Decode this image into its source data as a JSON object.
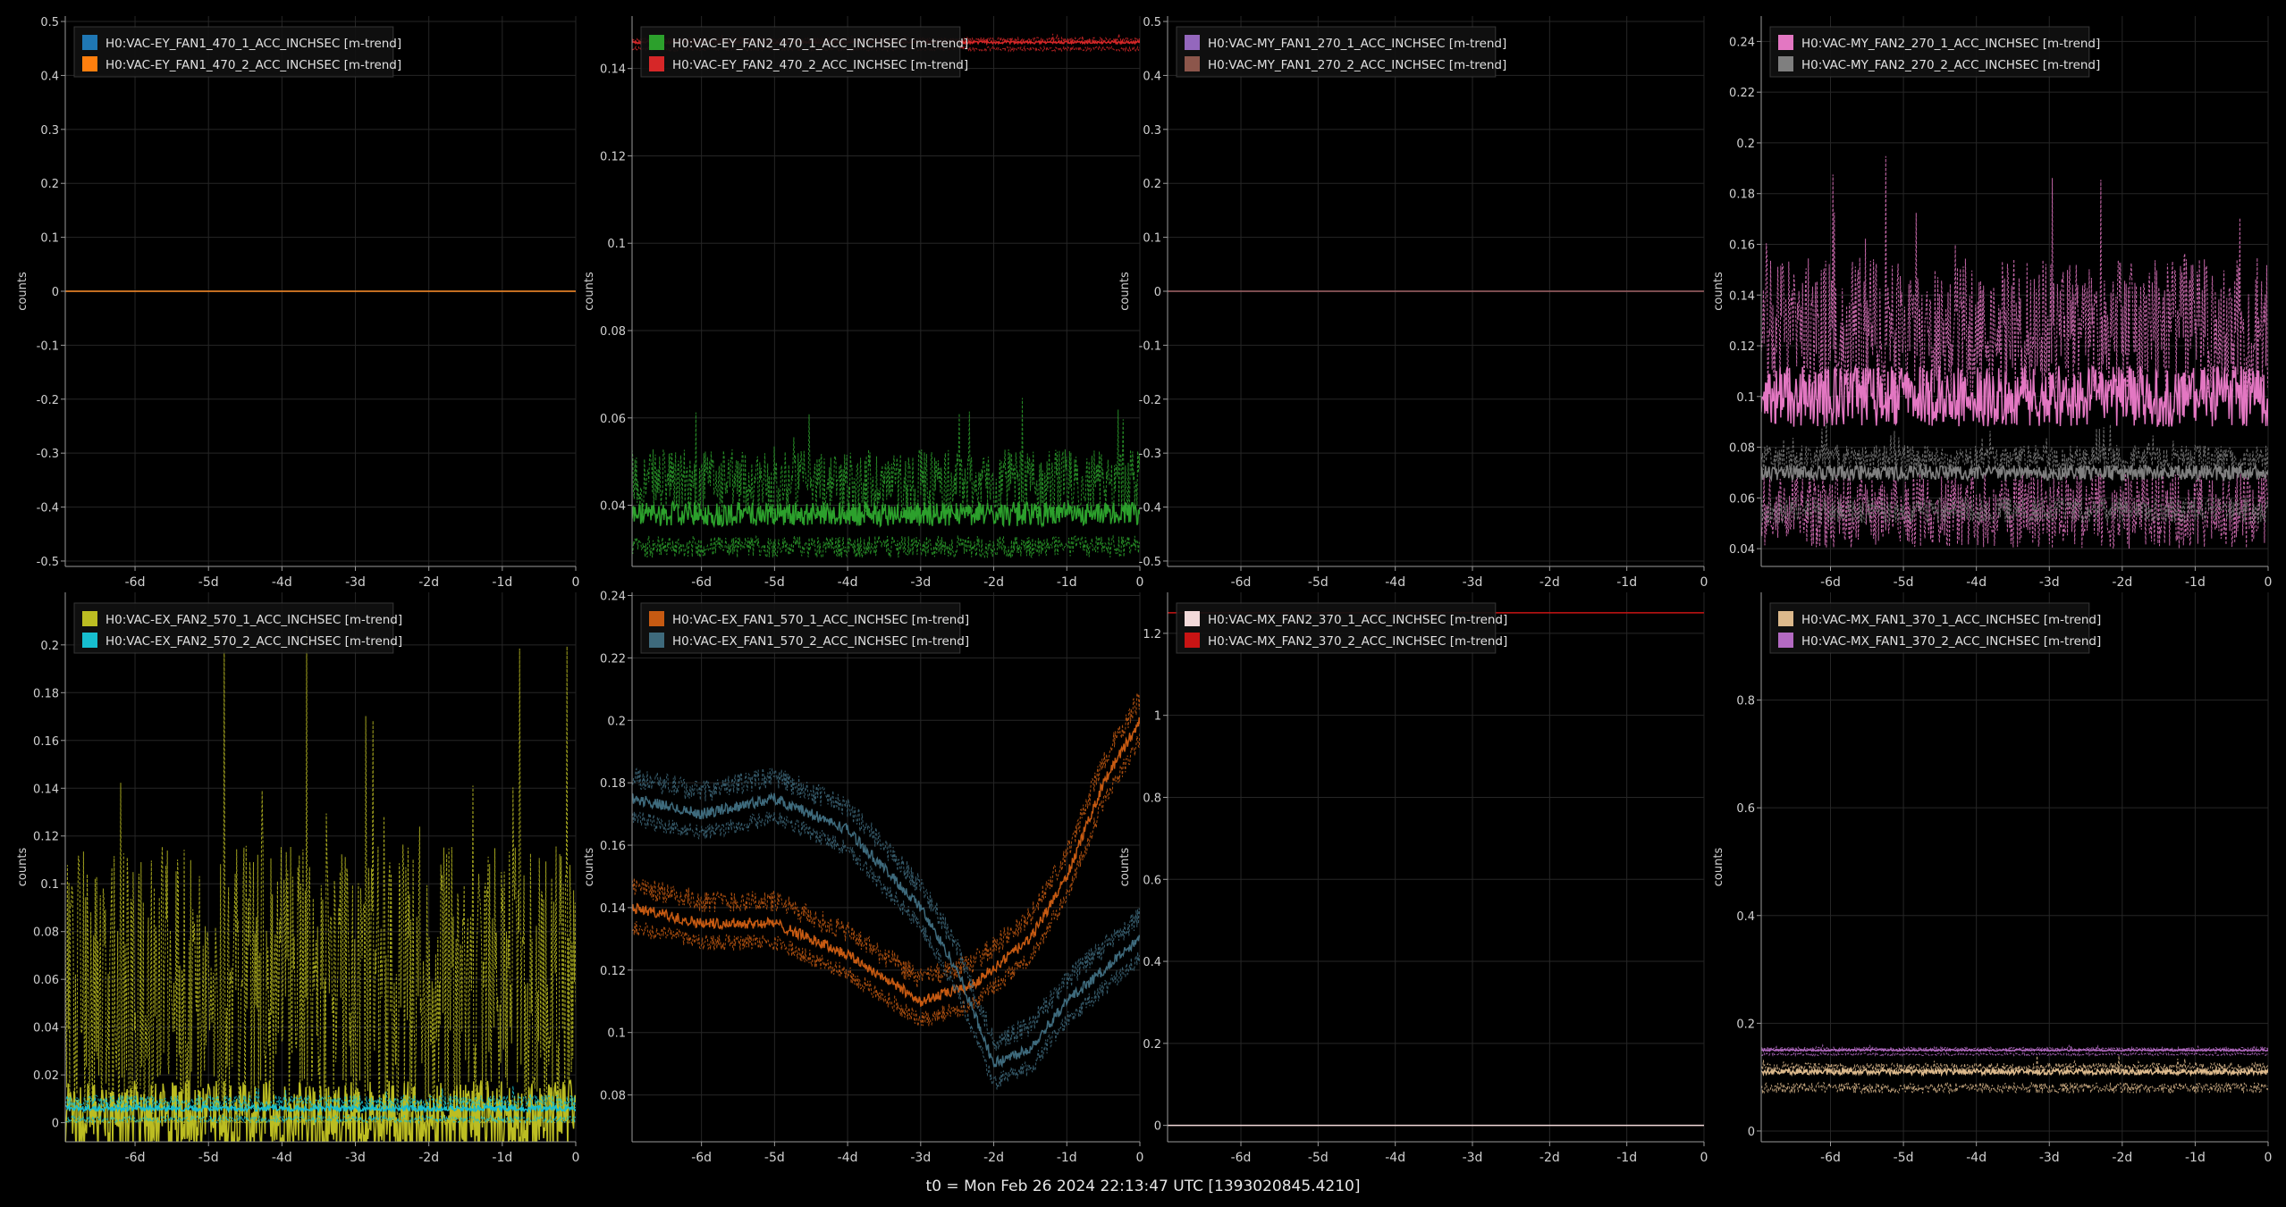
{
  "footer": "t0 = Mon Feb 26 2024 22:13:47 UTC [1393020845.4210]",
  "common": {
    "ylabel": "counts",
    "x_ticks": [
      -6,
      -5,
      -4,
      -3,
      -2,
      -1,
      0
    ],
    "x_tick_labels": [
      "-6d",
      "-5d",
      "-4d",
      "-3d",
      "-2d",
      "-1d",
      "0"
    ],
    "xlim": [
      -6.95,
      0
    ]
  },
  "chart_data": [
    {
      "type": "line",
      "ylim": [
        -0.51,
        0.51
      ],
      "y_ticks": [
        -0.5,
        -0.4,
        -0.3,
        -0.2,
        -0.1,
        0,
        0.1,
        0.2,
        0.3,
        0.4,
        0.5
      ],
      "y_tick_labels": [
        "-0.5",
        "-0.4",
        "-0.3",
        "-0.2",
        "-0.1",
        "0",
        "0.1",
        "0.2",
        "0.3",
        "0.4",
        "0.5"
      ],
      "series": [
        {
          "name": "H0:VAC-EY_FAN1_470_1_ACC_INCHSEC [m-trend]",
          "color": "#1f77b4",
          "mean": 0,
          "low": 0,
          "high": 0
        },
        {
          "name": "H0:VAC-EY_FAN1_470_2_ACC_INCHSEC [m-trend]",
          "color": "#ff7f0e",
          "mean": 0,
          "low": 0,
          "high": 0
        }
      ]
    },
    {
      "type": "line",
      "ylim": [
        0.026,
        0.152
      ],
      "y_ticks": [
        0.04,
        0.06,
        0.08,
        0.1,
        0.12,
        0.14
      ],
      "y_tick_labels": [
        "0.04",
        "0.06",
        "0.08",
        "0.1",
        "0.12",
        "0.14"
      ],
      "series": [
        {
          "name": "H0:VAC-EY_FAN2_470_1_ACC_INCHSEC [m-trend]",
          "color": "#2ca02c",
          "mean": 0.038,
          "low": 0.028,
          "high": 0.065
        },
        {
          "name": "H0:VAC-EY_FAN2_470_2_ACC_INCHSEC [m-trend]",
          "color": "#d62728",
          "mean": 0.146,
          "low": 0.144,
          "high": 0.148
        }
      ]
    },
    {
      "type": "line",
      "ylim": [
        -0.51,
        0.51
      ],
      "y_ticks": [
        -0.5,
        -0.4,
        -0.3,
        -0.2,
        -0.1,
        0,
        0.1,
        0.2,
        0.3,
        0.4,
        0.5
      ],
      "y_tick_labels": [
        "-0.5",
        "-0.4",
        "-0.3",
        "-0.2",
        "-0.1",
        "0",
        "0.1",
        "0.2",
        "0.3",
        "0.4",
        "0.5"
      ],
      "series": [
        {
          "name": "H0:VAC-MY_FAN1_270_1_ACC_INCHSEC [m-trend]",
          "color": "#9467bd",
          "mean": 0,
          "low": 0,
          "high": 0
        },
        {
          "name": "H0:VAC-MY_FAN1_270_2_ACC_INCHSEC [m-trend]",
          "color": "#8c564b",
          "mean": 0,
          "low": 0,
          "high": 0
        }
      ]
    },
    {
      "type": "line",
      "ylim": [
        0.033,
        0.25
      ],
      "y_ticks": [
        0.04,
        0.06,
        0.08,
        0.1,
        0.12,
        0.14,
        0.16,
        0.18,
        0.2,
        0.22,
        0.24
      ],
      "y_tick_labels": [
        "0.04",
        "0.06",
        "0.08",
        "0.1",
        "0.12",
        "0.14",
        "0.16",
        "0.18",
        "0.2",
        "0.22",
        "0.24"
      ],
      "series": [
        {
          "name": "H0:VAC-MY_FAN2_270_1_ACC_INCHSEC [m-trend]",
          "color": "#e377c2",
          "mean": 0.1,
          "low": 0.04,
          "high": 0.2
        },
        {
          "name": "H0:VAC-MY_FAN2_270_2_ACC_INCHSEC [m-trend]",
          "color": "#7f7f7f",
          "mean": 0.07,
          "low": 0.05,
          "high": 0.09
        }
      ]
    },
    {
      "type": "line",
      "ylim": [
        -0.008,
        0.222
      ],
      "y_ticks": [
        0,
        0.02,
        0.04,
        0.06,
        0.08,
        0.1,
        0.12,
        0.14,
        0.16,
        0.18,
        0.2
      ],
      "y_tick_labels": [
        "0",
        "0.02",
        "0.04",
        "0.06",
        "0.08",
        "0.1",
        "0.12",
        "0.14",
        "0.16",
        "0.18",
        "0.2"
      ],
      "series": [
        {
          "name": "H0:VAC-EX_FAN2_570_1_ACC_INCHSEC [m-trend]",
          "color": "#bcbd22",
          "mean": 0.002,
          "low": 0,
          "high": 0.21
        },
        {
          "name": "H0:VAC-EX_FAN2_570_2_ACC_INCHSEC [m-trend]",
          "color": "#17becf",
          "mean": 0.006,
          "low": 0,
          "high": 0.016
        }
      ]
    },
    {
      "type": "line",
      "ylim": [
        0.065,
        0.241
      ],
      "y_ticks": [
        0.08,
        0.1,
        0.12,
        0.14,
        0.16,
        0.18,
        0.2,
        0.22,
        0.24
      ],
      "y_tick_labels": [
        "0.08",
        "0.1",
        "0.12",
        "0.14",
        "0.16",
        "0.18",
        "0.2",
        "0.22",
        "0.24"
      ],
      "series": [
        {
          "name": "H0:VAC-EX_FAN1_570_1_ACC_INCHSEC [m-trend]",
          "color": "#c65a12",
          "x": [
            -6.95,
            -6,
            -5,
            -4,
            -3,
            -2.3,
            -1.5,
            -1,
            -0.5,
            0
          ],
          "y": [
            0.14,
            0.135,
            0.135,
            0.125,
            0.11,
            0.115,
            0.13,
            0.15,
            0.18,
            0.2
          ]
        },
        {
          "name": "H0:VAC-EX_FAN1_570_2_ACC_INCHSEC [m-trend]",
          "color": "#3e6a7c",
          "x": [
            -6.95,
            -6,
            -5,
            -4,
            -3,
            -2.5,
            -2,
            -1.5,
            -1,
            -0.5,
            0
          ],
          "y": [
            0.175,
            0.17,
            0.175,
            0.165,
            0.14,
            0.12,
            0.09,
            0.095,
            0.11,
            0.12,
            0.13
          ]
        }
      ]
    },
    {
      "type": "line",
      "ylim": [
        -0.04,
        1.3
      ],
      "y_ticks": [
        0,
        0.2,
        0.4,
        0.6,
        0.8,
        1,
        1.2
      ],
      "y_tick_labels": [
        "0",
        "0.2",
        "0.4",
        "0.6",
        "0.8",
        "1",
        "1.2"
      ],
      "series": [
        {
          "name": "H0:VAC-MX_FAN2_370_1_ACC_INCHSEC [m-trend]",
          "color": "#f2d9d9",
          "mean": 0,
          "low": 0,
          "high": 0
        },
        {
          "name": "H0:VAC-MX_FAN2_370_2_ACC_INCHSEC [m-trend]",
          "color": "#c81414",
          "mean": 1.25,
          "low": 1.25,
          "high": 1.25
        }
      ]
    },
    {
      "type": "line",
      "ylim": [
        -0.02,
        1.0
      ],
      "y_ticks": [
        0,
        0.2,
        0.4,
        0.6,
        0.8
      ],
      "y_tick_labels": [
        "0",
        "0.2",
        "0.4",
        "0.6",
        "0.8"
      ],
      "series": [
        {
          "name": "H0:VAC-MX_FAN1_370_1_ACC_INCHSEC [m-trend]",
          "color": "#dcb98c",
          "mean": 0.11,
          "low": 0.07,
          "high": 0.14
        },
        {
          "name": "H0:VAC-MX_FAN1_370_2_ACC_INCHSEC [m-trend]",
          "color": "#b36ac2",
          "mean": 0.15,
          "low": 0.14,
          "high": 0.16
        }
      ]
    }
  ]
}
